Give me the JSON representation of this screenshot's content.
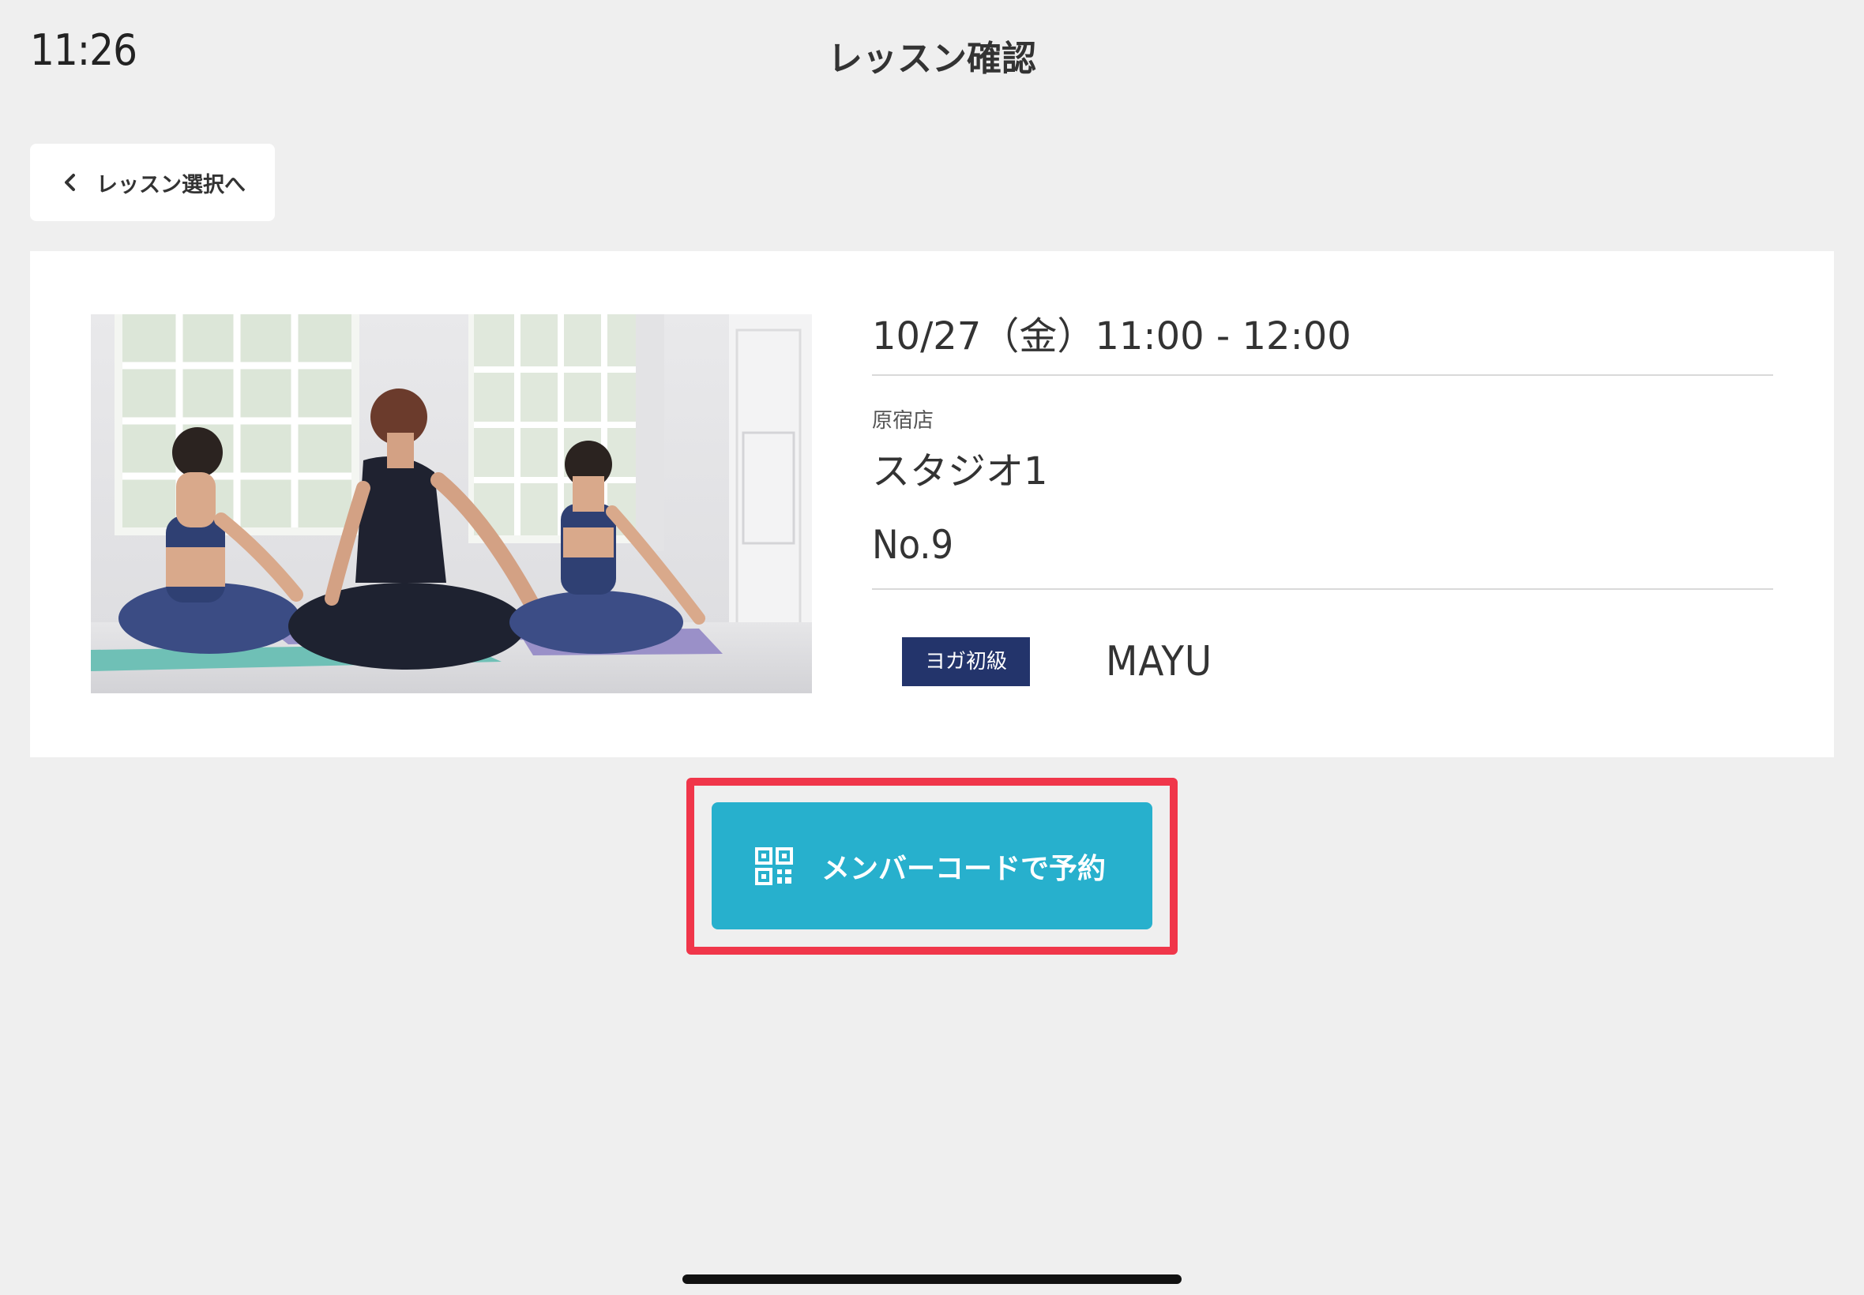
{
  "status_bar": {
    "time": "11:26"
  },
  "header": {
    "title": "レッスン確認"
  },
  "back_button": {
    "label": "レッスン選択へ",
    "icon": "chevron-left-icon"
  },
  "lesson": {
    "datetime": "10/27（金）11:00 - 12:00",
    "store": "原宿店",
    "studio": "スタジオ1",
    "seat": "No.9",
    "level": "ヨガ初級",
    "instructor": "MAYU",
    "photo": "yoga-class-photo"
  },
  "reserve_button": {
    "label": "メンバーコードで予約",
    "icon": "qr-code-icon"
  },
  "colors": {
    "background": "#efefef",
    "card": "#ffffff",
    "badge": "#23346b",
    "button": "#27b0cd",
    "highlight": "#f0364a"
  }
}
